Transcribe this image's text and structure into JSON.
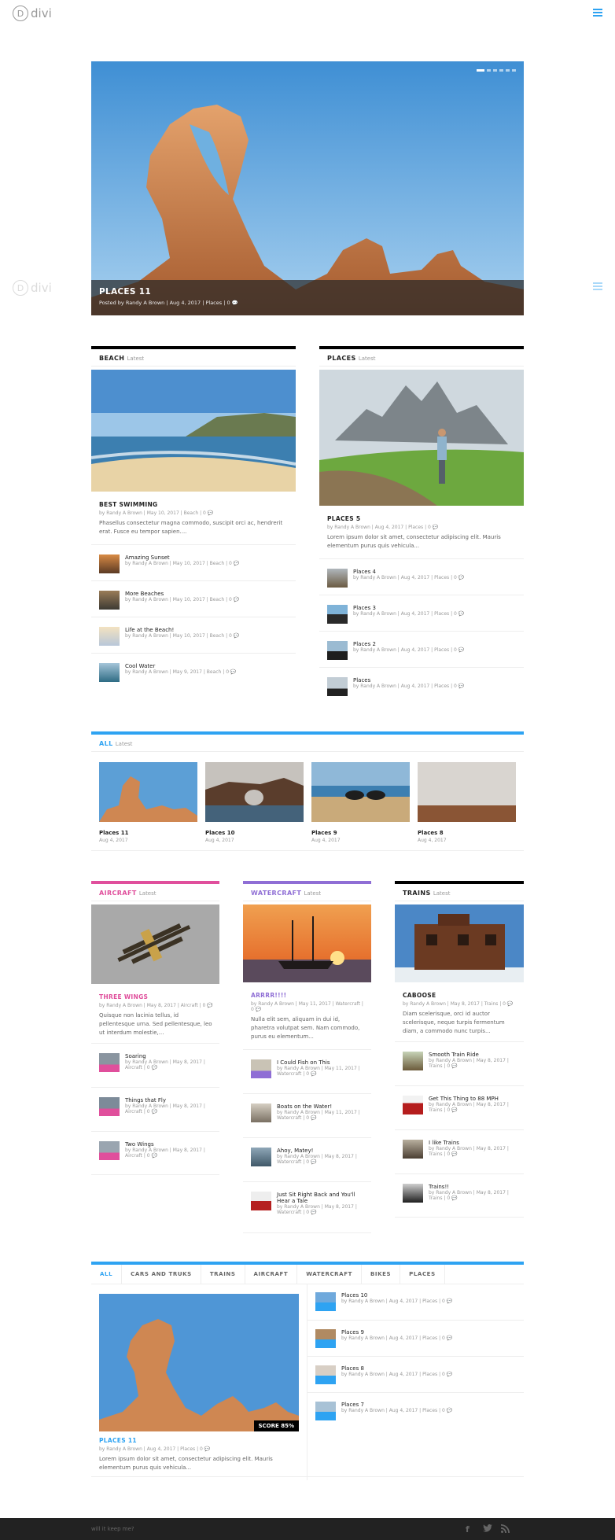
{
  "header": {
    "logo_text": "divi"
  },
  "hero": {
    "title": "PLACES 11",
    "meta": "Posted by Randy A Brown | Aug 4, 2017 | Places | 0 💬"
  },
  "beach": {
    "heading": "BEACH",
    "latest": "Latest",
    "featured": {
      "title": "BEST SWIMMING",
      "meta": "by Randy A Brown | May 10, 2017 | Beach | 0 💬",
      "excerpt": "Phasellus consectetur magna commodo, suscipit orci ac, hendrerit erat. Fusce eu tempor sapien...."
    },
    "items": [
      {
        "title": "Amazing Sunset",
        "meta": "by Randy A Brown | May 10, 2017 | Beach | 0 💬"
      },
      {
        "title": "More Beaches",
        "meta": "by Randy A Brown | May 10, 2017 | Beach | 0 💬"
      },
      {
        "title": "Life at the Beach!",
        "meta": "by Randy A Brown | May 10, 2017 | Beach | 0 💬"
      },
      {
        "title": "Cool Water",
        "meta": "by Randy A Brown | May 9, 2017 | Beach | 0 💬"
      }
    ]
  },
  "places": {
    "heading": "PLACES",
    "latest": "Latest",
    "featured": {
      "title": "PLACES 5",
      "meta": "by Randy A Brown | Aug 4, 2017 | Places | 0 💬",
      "excerpt": "Lorem ipsum dolor sit amet, consectetur adipiscing elit. Mauris elementum purus quis vehicula..."
    },
    "items": [
      {
        "title": "Places 4",
        "meta": "by Randy A Brown | Aug 4, 2017 | Places | 0 💬"
      },
      {
        "title": "Places 3",
        "meta": "by Randy A Brown | Aug 4, 2017 | Places | 0 💬"
      },
      {
        "title": "Places 2",
        "meta": "by Randy A Brown | Aug 4, 2017 | Places | 0 💬"
      },
      {
        "title": "Places",
        "meta": "by Randy A Brown | Aug 4, 2017 | Places | 0 💬"
      }
    ]
  },
  "all": {
    "heading": "ALL",
    "latest": "Latest",
    "items": [
      {
        "title": "Places 11",
        "date": "Aug 4, 2017"
      },
      {
        "title": "Places 10",
        "date": "Aug 4, 2017"
      },
      {
        "title": "Places 9",
        "date": "Aug 4, 2017"
      },
      {
        "title": "Places 8",
        "date": "Aug 4, 2017"
      }
    ]
  },
  "aircraft": {
    "heading": "AIRCRAFT",
    "latest": "Latest",
    "color": "#e04f9c",
    "featured": {
      "title": "THREE WINGS",
      "meta": "by Randy A Brown | May 8, 2017 | Aircraft | 0 💬",
      "excerpt": "Quisque non lacinia tellus, id pellentesque urna. Sed pellentesque, leo ut interdum molestie,..."
    },
    "items": [
      {
        "title": "Soaring",
        "meta1": "by Randy A Brown | May 8, 2017 |",
        "meta2": "Aircraft | 0 💬"
      },
      {
        "title": "Things that Fly",
        "meta1": "by Randy A Brown | May 8, 2017 |",
        "meta2": "Aircraft | 0 💬"
      },
      {
        "title": "Two Wings",
        "meta1": "by Randy A Brown | May 8, 2017 |",
        "meta2": "Aircraft | 0 💬"
      }
    ]
  },
  "watercraft": {
    "heading": "WATERCRAFT",
    "latest": "Latest",
    "color": "#8f6ed5",
    "featured": {
      "title": "ARRRR!!!!",
      "meta": "by Randy A Brown | May 11, 2017 | Watercraft | 0 💬",
      "excerpt": "Nulla elit sem, aliquam in dui id, pharetra volutpat sem. Nam commodo, purus eu elementum..."
    },
    "items": [
      {
        "title": "I Could Fish on This",
        "title2": "",
        "meta1": "by Randy A Brown | May 11, 2017 |",
        "meta2": "Watercraft | 0 💬"
      },
      {
        "title": "Boats on the Water!",
        "title2": "",
        "meta1": "by Randy A Brown | May 11, 2017 |",
        "meta2": "Watercraft | 0 💬"
      },
      {
        "title": "Ahoy, Matey!",
        "title2": "",
        "meta1": "by Randy A Brown | May 8, 2017 |",
        "meta2": "Watercraft | 0 💬"
      },
      {
        "title": "Just Sit Right Back and You'll",
        "title2": "Hear a Tale",
        "meta1": "by Randy A Brown | May 8, 2017 |",
        "meta2": "Watercraft | 0 💬"
      }
    ]
  },
  "trains": {
    "heading": "TRAINS",
    "latest": "Latest",
    "featured": {
      "title": "CABOOSE",
      "meta": "by Randy A Brown | May 8, 2017 | Trains | 0 💬",
      "excerpt": "Diam scelerisque, orci id auctor scelerisque, neque turpis fermentum diam, a commodo nunc turpis..."
    },
    "items": [
      {
        "title": "Smooth Train Ride",
        "meta1": "by Randy A Brown | May 8, 2017 |",
        "meta2": "Trains | 0 💬"
      },
      {
        "title": "Get This Thing to 88 MPH",
        "meta1": "by Randy A Brown | May 8, 2017 |",
        "meta2": "Trains | 0 💬"
      },
      {
        "title": "I like Trains",
        "meta1": "by Randy A Brown | May 8, 2017 |",
        "meta2": "Trains | 0 💬"
      },
      {
        "title": "Trains!!",
        "meta1": "by Randy A Brown | May 8, 2017 |",
        "meta2": "Trains | 0 💬"
      }
    ]
  },
  "tabbed": {
    "tabs": [
      "ALL",
      "CARS AND TRUKS",
      "TRAINS",
      "AIRCRAFT",
      "WATERCRAFT",
      "BIKES",
      "PLACES"
    ],
    "featured": {
      "title": "PLACES 11",
      "meta": "by Randy A Brown | Aug 4, 2017 | Places | 0 💬",
      "excerpt": "Lorem ipsum dolor sit amet, consectetur adipiscing elit. Mauris elementum purus quis vehicula...",
      "score": "SCORE 85%"
    },
    "items": [
      {
        "title": "Places 10",
        "meta": "by Randy A Brown | Aug 4, 2017 | Places | 0 💬"
      },
      {
        "title": "Places 9",
        "meta": "by Randy A Brown | Aug 4, 2017 | Places | 0 💬"
      },
      {
        "title": "Places 8",
        "meta": "by Randy A Brown | Aug 4, 2017 | Places | 0 💬"
      },
      {
        "title": "Places 7",
        "meta": "by Randy A Brown | Aug 4, 2017 | Places | 0 💬"
      }
    ]
  },
  "footer": {
    "text": "will it keep me?"
  },
  "colors": {
    "accent": "#2ea3f2",
    "aircraft": "#e04f9c",
    "watercraft": "#8f6ed5",
    "footer": "#222222"
  }
}
